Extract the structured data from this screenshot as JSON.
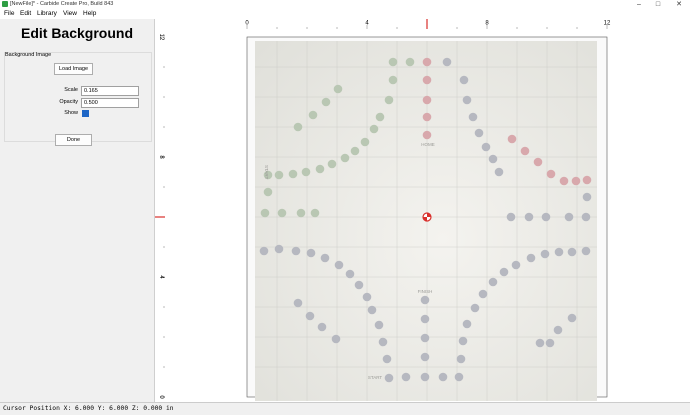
{
  "window": {
    "title": "[NewFile]* - Carbide Create Pro, Build 843",
    "controls": [
      "minimize-icon",
      "maximize-icon",
      "close-icon"
    ]
  },
  "menu": {
    "items": [
      "File",
      "Edit",
      "Library",
      "View",
      "Help"
    ]
  },
  "panel": {
    "title": "Edit Background",
    "group_label": "Background Image",
    "load_button": "Load Image",
    "scale_label": "Scale",
    "scale_value": "0.165",
    "opacity_label": "Opacity",
    "opacity_value": "0.500",
    "show_label": "Show",
    "show_checked": true,
    "done_button": "Done"
  },
  "rulers": {
    "horizontal_labels": [
      "0",
      "4",
      "8",
      "12"
    ],
    "vertical_labels": [
      "12",
      "8",
      "4",
      "0"
    ]
  },
  "background_image": {
    "labels": [
      "HOME",
      "FINISH",
      "FINISH",
      "START",
      "START"
    ]
  },
  "status": {
    "cursor": "Cursor Position X: 6.000 Y: 6.000 Z: 0.000 in"
  },
  "colors": {
    "origin_marker": "#d9302c",
    "hole_green": "#b9c7b3",
    "hole_red": "#d8a8ac",
    "hole_gray": "#b6b8c0",
    "accent": "#1e66c6"
  }
}
